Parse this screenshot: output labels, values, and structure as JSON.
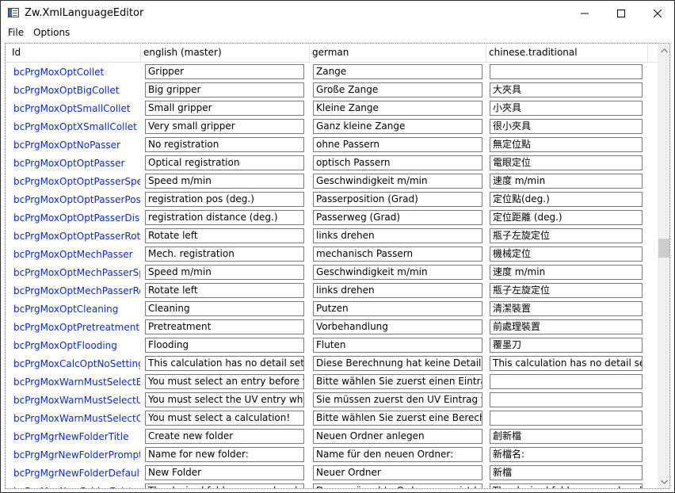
{
  "window": {
    "title": "Zw.XmlLanguageEditor",
    "minimize_icon": "minimize-icon",
    "maximize_icon": "maximize-icon",
    "close_icon": "close-icon",
    "app_icon": "app-window-icon"
  },
  "menu": [
    "File",
    "Options"
  ],
  "colors": {
    "id_text": "#0b2db4",
    "border": "#7a7a7a",
    "scrollbar_track": "#f0f0f0",
    "scrollbar_thumb": "#cdcdcd"
  },
  "columns": [
    "Id",
    "english (master)",
    "german",
    "chinese.traditional"
  ],
  "rows": [
    {
      "id": "bcPrgMoxOptCollet",
      "en": "Gripper",
      "de": "Zange",
      "zh": ""
    },
    {
      "id": "bcPrgMoxOptBigCollet",
      "en": "Big gripper",
      "de": "Große Zange",
      "zh": "大夾具"
    },
    {
      "id": "bcPrgMoxOptSmallCollet",
      "en": "Small gripper",
      "de": "Kleine Zange",
      "zh": "小夾具"
    },
    {
      "id": "bcPrgMoxOptXSmallCollet",
      "en": "Very small gripper",
      "de": "Ganz kleine Zange",
      "zh": "很小夾具"
    },
    {
      "id": "bcPrgMoxOptNoPasser",
      "en": "No registration",
      "de": "ohne Passern",
      "zh": "無定位點"
    },
    {
      "id": "bcPrgMoxOptOptPasser",
      "en": "Optical registration",
      "de": "optisch Passern",
      "zh": "電眼定位"
    },
    {
      "id": "bcPrgMoxOptOptPasserSpeed",
      "en": "Speed m/min",
      "de": "Geschwindigkeit m/min",
      "zh": "速度 m/min"
    },
    {
      "id": "bcPrgMoxOptOptPasserPos",
      "en": "registration pos (deg.)",
      "de": "Passerposition (Grad)",
      "zh": "定位點(deg.)"
    },
    {
      "id": "bcPrgMoxOptOptPasserDistance",
      "en": "registration distance (deg.)",
      "de": "Passerweg (Grad)",
      "zh": "定位距離 (deg.)"
    },
    {
      "id": "bcPrgMoxOptOptPasserRotLeft",
      "en": "Rotate left",
      "de": "links drehen",
      "zh": "瓶子左旋定位"
    },
    {
      "id": "bcPrgMoxOptMechPasser",
      "en": "Mech. registration",
      "de": "mechanisch Passern",
      "zh": "機械定位"
    },
    {
      "id": "bcPrgMoxOptMechPasserSpeed",
      "en": "Speed m/min",
      "de": "Geschwindigkeit m/min",
      "zh": "速度 m/min"
    },
    {
      "id": "bcPrgMoxOptMechPasserRotLeft",
      "en": "Rotate left",
      "de": "links drehen",
      "zh": "瓶子左旋定位"
    },
    {
      "id": "bcPrgMoxOptCleaning",
      "en": "Cleaning",
      "de": "Putzen",
      "zh": "清潔裝置"
    },
    {
      "id": "bcPrgMoxOptPretreatment",
      "en": "Pretreatment",
      "de": "Vorbehandlung",
      "zh": "前處理裝置"
    },
    {
      "id": "bcPrgMoxOptFlooding",
      "en": "Flooding",
      "de": "Fluten",
      "zh": "覆墨刀"
    },
    {
      "id": "bcPrgMoxCalcOptNoSettings",
      "en": "This calculation has no detail settings",
      "de": "Diese Berechnung hat keine Detaileinstellungen",
      "zh": "This calculation has no detail settings"
    },
    {
      "id": "bcPrgMoxWarnMustSelectEntry",
      "en": "You must select an entry before you can",
      "de": "Bitte wählen Sie zuerst einen Eintrag hinzu",
      "zh": ""
    },
    {
      "id": "bcPrgMoxWarnMustSelectUvEntry",
      "en": "You must select the UV entry which you",
      "de": "Sie müssen zuerst den UV Eintrag wählen",
      "zh": ""
    },
    {
      "id": "bcPrgMoxWarnMustSelectCalc",
      "en": "You must select a calculation!",
      "de": "Bitte wählen Sie zuerst eine Berechnung",
      "zh": ""
    },
    {
      "id": "bcPrgMgrNewFolderTitle",
      "en": "Create new folder",
      "de": "Neuen Ordner anlegen",
      "zh": "創新檔"
    },
    {
      "id": "bcPrgMgrNewFolderPrompt",
      "en": "Name for new folder:",
      "de": "Name für den neuen Ordner:",
      "zh": "新檔名:"
    },
    {
      "id": "bcPrgMgrNewFolderDefault",
      "en": "New Folder",
      "de": "Neuer Ordner",
      "zh": "新檔"
    },
    {
      "id": "bcPrgMoxNewFolderExists",
      "en": "The desired folder name already exists",
      "de": "Der gewünschte Ordnername ist bereits vorhanden",
      "zh": "The desired folder name already exists"
    }
  ]
}
